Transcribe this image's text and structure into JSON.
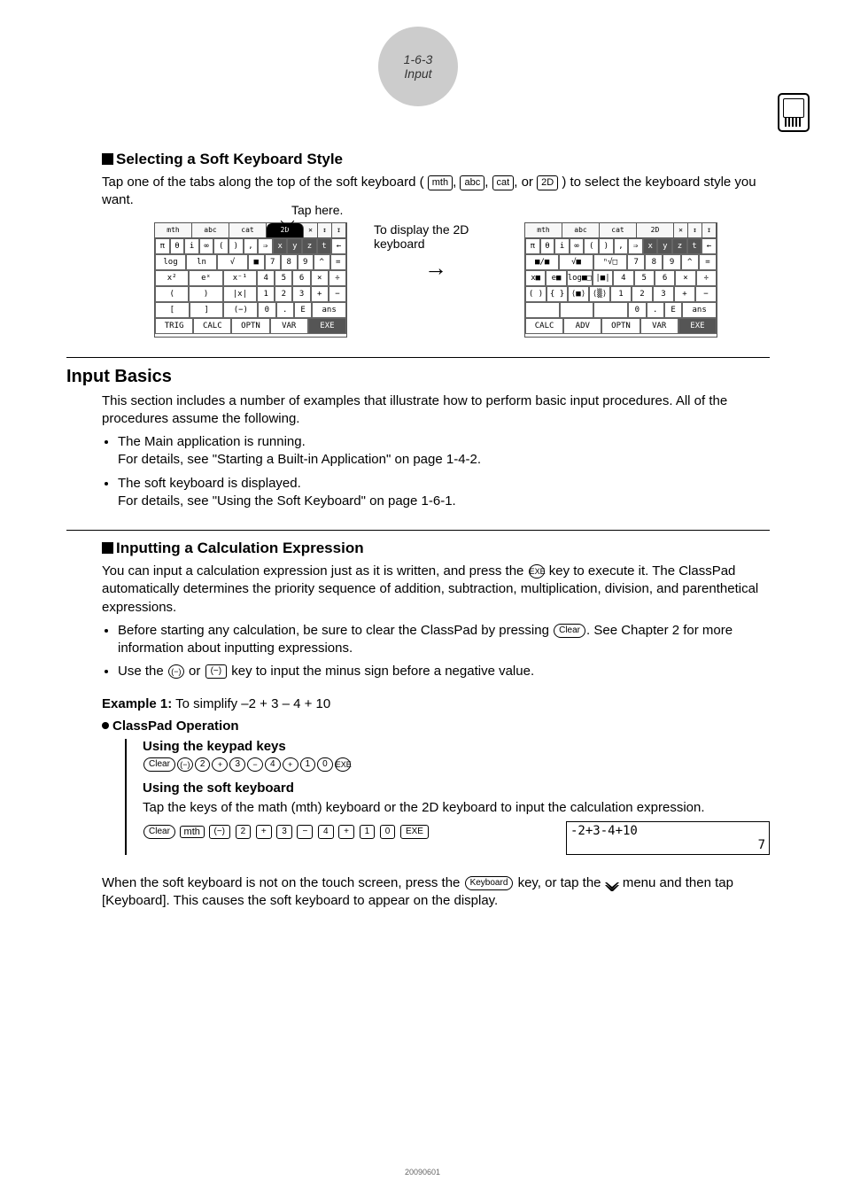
{
  "header": {
    "line1": "1-6-3",
    "line2": "Input"
  },
  "sec1": {
    "title": "Selecting a Soft Keyboard Style",
    "para_before": "Tap one of the tabs along the top of the soft keyboard (",
    "tabs": {
      "mth": "mth",
      "abc": "abc",
      "cat": "cat",
      "twod": "2D"
    },
    "para_after": ") to select the keyboard style you want.",
    "taphere": "Tap here.",
    "mid1": "To display the 2D keyboard",
    "mth_tabs": [
      "mth",
      "abc",
      "cat",
      "2D"
    ],
    "mth_row1": [
      "π",
      "θ",
      "i",
      "∞",
      "(",
      ")",
      ",",
      "⇒",
      "x",
      "y",
      "z",
      "t",
      "←"
    ],
    "mth_row2": [
      "log",
      "ln",
      "√",
      "■",
      "7",
      "8",
      "9",
      "^",
      "="
    ],
    "mth_row3": [
      "x²",
      "eˣ",
      "x⁻¹",
      "4",
      "5",
      "6",
      "×",
      "÷"
    ],
    "mth_row4": [
      "(",
      ")",
      "|x|",
      "1",
      "2",
      "3",
      "+",
      "−"
    ],
    "mth_row5": [
      "[",
      "]",
      "(−)",
      "0",
      ".",
      "E",
      "ans"
    ],
    "mth_row6": [
      "TRIG",
      "CALC",
      "OPTN",
      "VAR",
      "EXE"
    ],
    "d2_row2a": [
      "■/■",
      "√■",
      "ⁿ√□",
      "7",
      "8",
      "9",
      "^",
      "="
    ],
    "d2_row2b": [
      "x■",
      "e■",
      "log■□",
      "|■|",
      "4",
      "5",
      "6",
      "×",
      "÷"
    ],
    "d2_row2c": [
      "( )",
      "{ }",
      "⟨■⟩",
      "⟨▒⟩",
      "1",
      "2",
      "3",
      "+",
      "−"
    ],
    "d2_row2d": [
      "0",
      ".",
      "E",
      "ans"
    ],
    "d2_row6": [
      "CALC",
      "ADV",
      "OPTN",
      "VAR",
      "EXE"
    ]
  },
  "inputbasics": {
    "title": "Input Basics",
    "intro": "This section includes a number of examples that illustrate how to perform basic input procedures. All of the procedures assume the following.",
    "b1a": "The Main application is running.",
    "b1b": "For details, see \"Starting a Built-in Application\" on page 1-4-2.",
    "b2a": "The soft keyboard is displayed.",
    "b2b": "For details, see \"Using the Soft Keyboard\" on page 1-6-1."
  },
  "sec2": {
    "title": "Inputting a Calculation Expression",
    "para1": "You can input a calculation expression just as it is written, and press the ",
    "para1b": " key to execute it. The ClassPad automatically determines the priority sequence of addition, subtraction, multiplication, division, and parenthetical expressions.",
    "bul1a": "Before starting any calculation, be sure to clear the ClassPad by pressing ",
    "bul1b": ". See Chapter 2 for more information about inputting expressions.",
    "bul2a": "Use the ",
    "bul2b": " or ",
    "bul2c": " key to input the minus sign before a negative value.",
    "example_lbl": "Example 1:",
    "example_txt": " To simplify –2 + 3 – 4 + 10",
    "opheader": "ClassPad Operation",
    "using_keypad": "Using the keypad keys",
    "using_soft": "Using the soft keyboard",
    "softdesc": "Tap the keys of the math (mth) keyboard or the 2D keyboard to input the calculation expression.",
    "result_expr": "-2+3-4+10",
    "result_ans": "7",
    "tail1": "When the soft keyboard is not on the touch screen, press the ",
    "tail2": " key, or tap the ",
    "tail3": " menu and then tap [Keyboard]. This causes the soft keyboard to appear on the display.",
    "keys": {
      "clear": "Clear",
      "exe": "EXE",
      "exe_s": "EXE",
      "mth": "mth",
      "neg": "(−)",
      "minus": "−",
      "plus": "+",
      "keyboard": "Keyboard",
      "k2": "2",
      "k3": "3",
      "k4": "4",
      "k1": "1",
      "k0": "0"
    }
  },
  "footer": "20090601"
}
